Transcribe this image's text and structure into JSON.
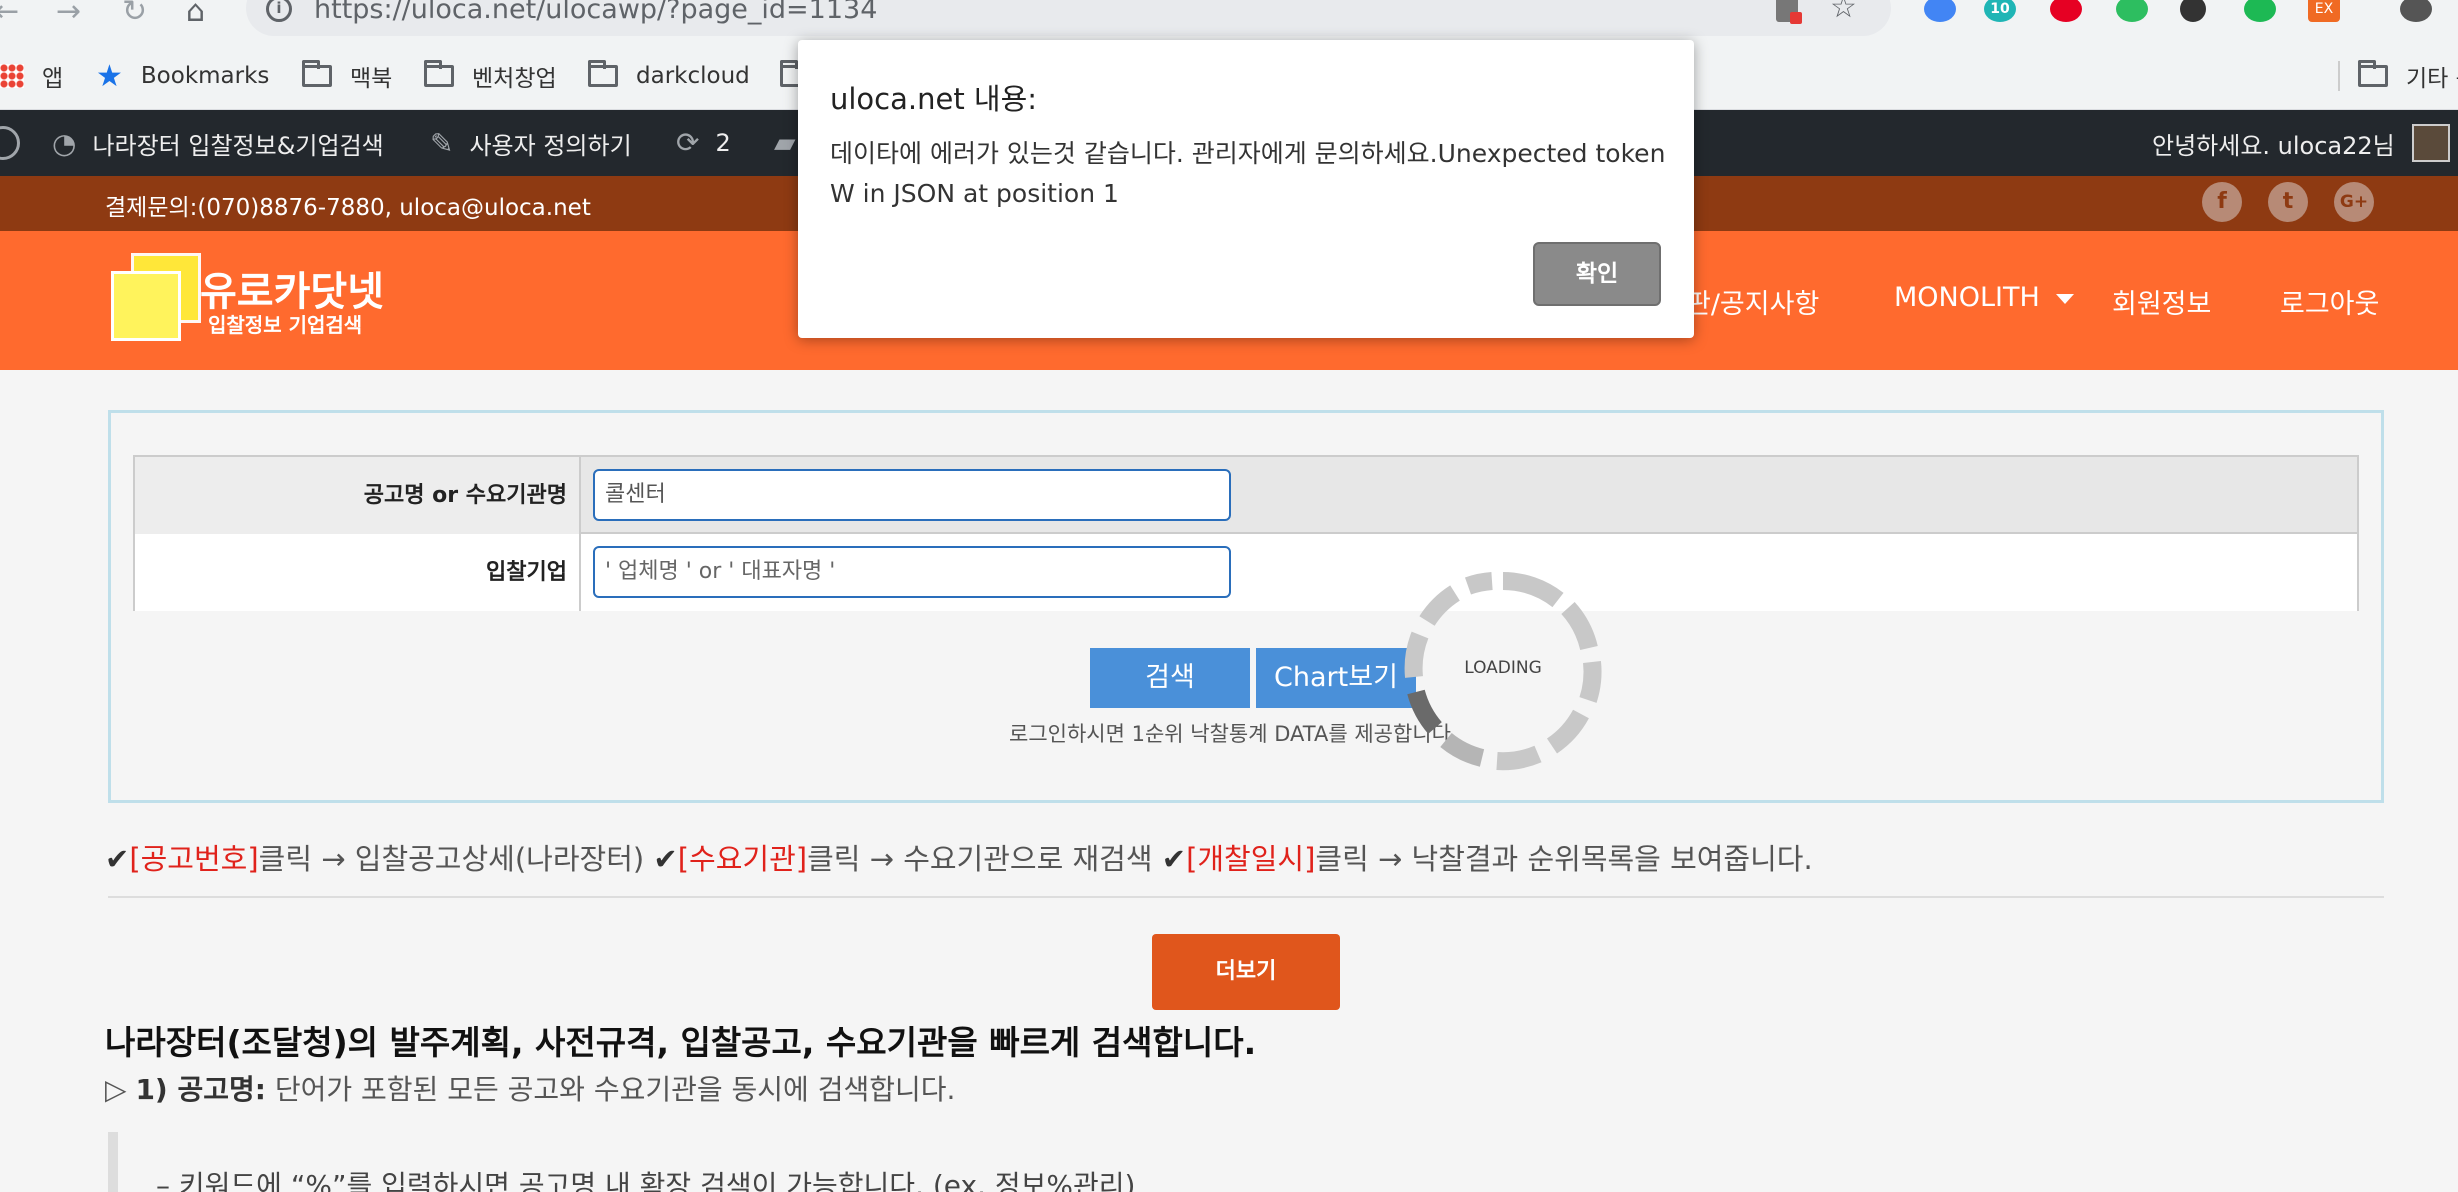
{
  "browser": {
    "url": "https://uloca.net/ulocawp/?page_id=1134",
    "bookmarks": [
      {
        "label": "앱",
        "icon": "apps-icon"
      },
      {
        "label": "Bookmarks",
        "icon": "star-icon"
      },
      {
        "label": "맥북",
        "icon": "folder-icon"
      },
      {
        "label": "벤처창업",
        "icon": "folder-icon"
      },
      {
        "label": "darkcloud",
        "icon": "folder-icon"
      }
    ],
    "other_bookmarks": "기타 북",
    "extension_labels": {
      "ext_shopping": "10",
      "ext_ex": "EX"
    }
  },
  "adminbar": {
    "site": "나라장터 입찰정보&기업검색",
    "customize": "사용자 정의하기",
    "updates": "2",
    "greeting": "안녕하세요. uloca22님"
  },
  "topbar": {
    "contact": "결제문의:(070)8876-7880, uloca@uloca.net",
    "social": {
      "facebook": "f",
      "twitter": "t",
      "gplus": "G+"
    }
  },
  "header": {
    "logo_title": "유로카닷넷",
    "logo_sub": "입찰정보 기업검색",
    "menu": {
      "notice": "판/공지사항",
      "monolith": "MONOLITH",
      "member": "회원정보",
      "logout": "로그아웃"
    }
  },
  "search": {
    "field1_label": "공고명 or 수요기관명",
    "field1_value": "콜센터",
    "field2_label": "입찰기업",
    "field2_placeholder": "' 업체명 ' or ' 대표자명 '",
    "search_button": "검색",
    "chart_button": "Chart보기",
    "hint": "로그인하시면 1순위 낙찰통계 DATA를 제공합니다.",
    "loading": "LOADING"
  },
  "guide": {
    "tick": "✔",
    "item1_key": "[공고번호]",
    "item1_text": "클릭 → 입찰공고상세(나라장터) ",
    "item2_key": "[수요기관]",
    "item2_text": "클릭 → 수요기관으로 재검색 ",
    "item3_key": "[개찰일시]",
    "item3_text": "클릭 → 낙찰결과 순위목록을 보여줍니다."
  },
  "more_button": "더보기",
  "content": {
    "heading": "나라장터(조달청)의 발주계획, 사전규격, 입찰공고, 수요기관을 빠르게 검색합니다.",
    "sub_prefix": "▷ ",
    "sub_bold": "1) 공고명:",
    "sub_text": " 단어가 포함된 모든 공고와 수요기관을 동시에 검색합니다.",
    "quote": "– 키워드에 “%”를 입력하시면 공고명 내 확장 검색이 가능합니다. (ex. 정보%관리)"
  },
  "dialog": {
    "title": "uloca.net 내용:",
    "message": "데이타에 에러가 있는것 같습니다. 관리자에게 문의하세요.Unexpected token W in JSON at position 1",
    "ok": "확인"
  },
  "colors": {
    "header_orange": "#ff6a2e",
    "topbar_brown": "#8e3a12",
    "button_blue": "#4a90d9",
    "more_orange": "#e0561c",
    "guide_red": "#e0221b"
  }
}
